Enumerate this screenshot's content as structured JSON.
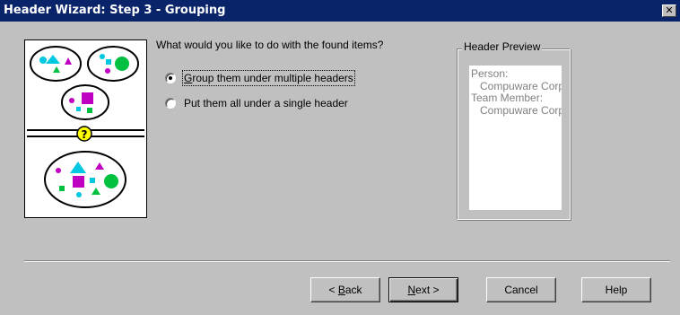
{
  "window": {
    "title": "Header Wizard: Step 3 - Grouping",
    "close_glyph": "✕"
  },
  "main": {
    "question": "What would you like to do with the found items?",
    "options": [
      {
        "label_underlined": "G",
        "label_rest": "roup them under multiple headers",
        "selected": true
      },
      {
        "label": "Put them all under a single header",
        "selected": false
      }
    ]
  },
  "preview": {
    "legend": "Header Preview",
    "lines": [
      "Person:",
      "Compuware Corporation:",
      "Team Member:",
      "Compuware Corporation:"
    ]
  },
  "illustration": {
    "question_mark": "?",
    "colors": {
      "cyan": "#00c8e0",
      "magenta": "#c000c0",
      "green": "#00c040",
      "yellow": "#ffff00"
    }
  },
  "buttons": {
    "back_prefix": "< ",
    "back_underlined": "B",
    "back_rest": "ack",
    "next_underlined": "N",
    "next_rest": "ext >",
    "cancel": "Cancel",
    "help": "Help"
  }
}
